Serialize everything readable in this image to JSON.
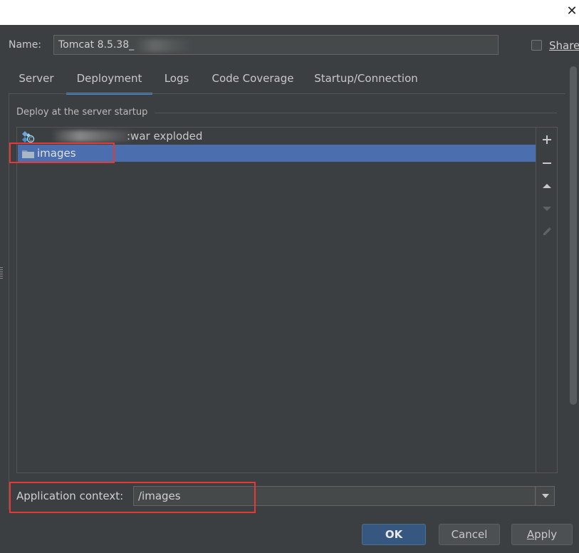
{
  "dialog": {
    "close_glyph": "✕"
  },
  "name_row": {
    "label": "Name:",
    "value": "Tomcat 8.5.38_",
    "share_label": "Share"
  },
  "tabs": [
    {
      "label": "Server",
      "active": false
    },
    {
      "label": "Deployment",
      "active": true
    },
    {
      "label": "Logs",
      "active": false
    },
    {
      "label": "Code Coverage",
      "active": false
    },
    {
      "label": "Startup/Connection",
      "active": false
    }
  ],
  "deployment": {
    "section_title": "Deploy at the server startup",
    "items": [
      {
        "label": ":war exploded",
        "icon": "artifact-icon",
        "selected": false
      },
      {
        "label": "images",
        "icon": "folder-icon",
        "selected": true
      }
    ],
    "tools": [
      "add-icon",
      "remove-icon",
      "move-up-icon",
      "move-down-icon",
      "edit-icon"
    ]
  },
  "context": {
    "label": "Application context:",
    "value": "/images"
  },
  "buttons": {
    "ok": "OK",
    "cancel": "Cancel",
    "apply_mnemonic": "A",
    "apply_rest": "pply"
  },
  "colors": {
    "background": "#3c3f41",
    "selection": "#4b6eaf",
    "accent_tab": "#4a88c7",
    "highlight_box": "#e53935",
    "ok_button": "#365880"
  }
}
